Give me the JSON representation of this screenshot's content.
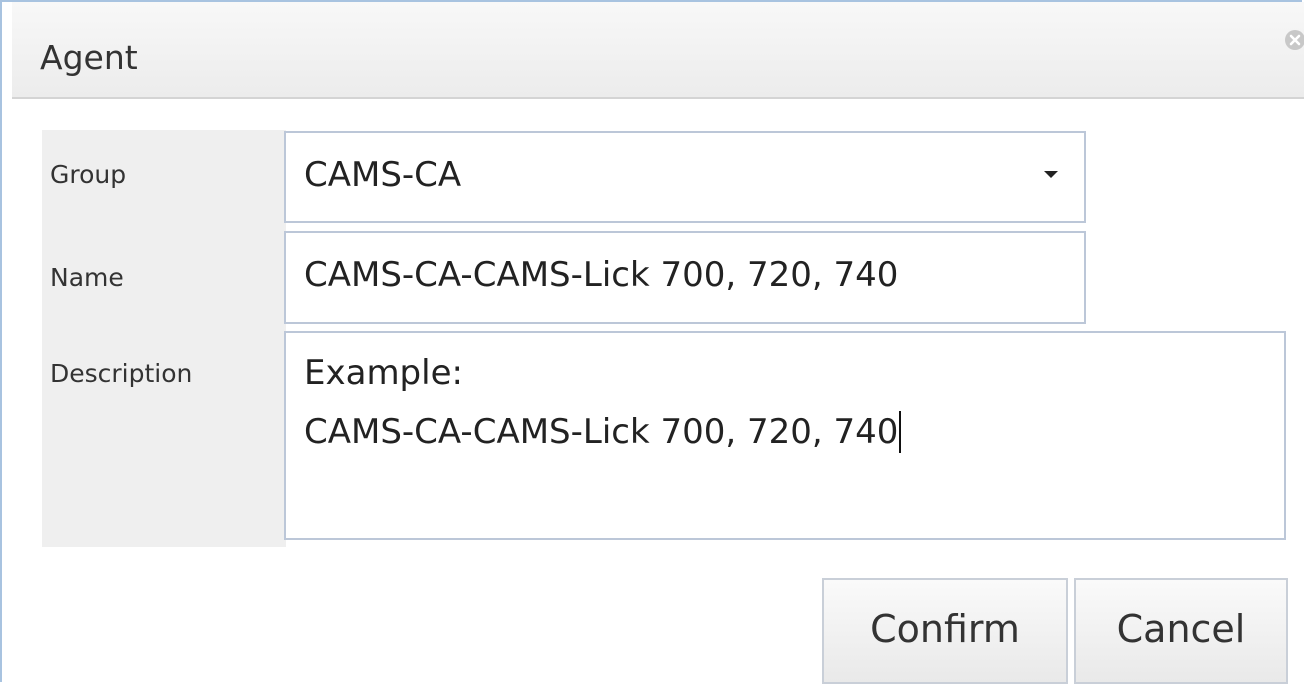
{
  "dialog": {
    "title": "Agent",
    "close_icon": "close-circle-icon"
  },
  "form": {
    "group": {
      "label": "Group",
      "value": "CAMS-CA"
    },
    "name": {
      "label": "Name",
      "value": "CAMS-CA-CAMS-Lick 700, 720, 740"
    },
    "description": {
      "label": "Description",
      "lines": [
        "Example:",
        "CAMS-CA-CAMS-Lick 700, 720, 740"
      ]
    }
  },
  "buttons": {
    "confirm_label": "Confirm",
    "cancel_label": "Cancel"
  }
}
